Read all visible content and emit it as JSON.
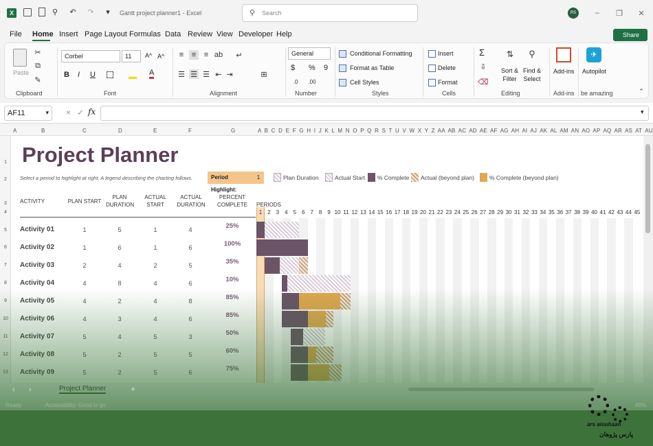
{
  "titlebar": {
    "file_title": "Gantt project planner1",
    "app": "Excel",
    "separator": " - ",
    "search_placeholder": "Search",
    "user_initials": "RS"
  },
  "menu": [
    "File",
    "Home",
    "Insert",
    "Page Layout",
    "Formulas",
    "Data",
    "Review",
    "View",
    "Developer",
    "Help"
  ],
  "share_label": "Share",
  "ribbon": {
    "clipboard": {
      "label": "Clipboard",
      "paste": "Paste"
    },
    "font": {
      "label": "Font",
      "name": "Corbel",
      "size": "11",
      "grow": "A^",
      "shrink": "A^",
      "bold": "B",
      "italic": "I",
      "underline": "U"
    },
    "alignment": {
      "label": "Alignment"
    },
    "number": {
      "label": "Number",
      "format": "General",
      "currency": "$",
      "percent": "%",
      "comma": "9"
    },
    "styles": {
      "label": "Styles",
      "conditional": "Conditional Formatting",
      "as_table": "Format as Table",
      "cell_styles": "Cell Styles"
    },
    "cells": {
      "label": "Cells",
      "insert": "Insert",
      "delete": "Delete",
      "format": "Format"
    },
    "editing": {
      "label": "Editing",
      "sum": "Σ",
      "sort_filter_1": "Sort &",
      "sort_filter_2": "Filter",
      "find_1": "Find &",
      "find_2": "Select"
    },
    "addins": {
      "label": "Add-ins",
      "button": "Add-ins"
    },
    "autopilot": {
      "label": "be amazing",
      "button": "Autopilot"
    }
  },
  "formula_bar": {
    "name_box": "AF11",
    "fx": "fx",
    "cancel": "×",
    "enter": "✓"
  },
  "columns": "A B C D E F G H I J K L M N O P Q R S T U V W X Y Z AA AB AC AD AE AF AG AH AI AJ AK AL AM AN AO AP AQ AR AS AT AU AV AW AX AY AZ",
  "col_labels": {
    "A": "A",
    "B": "B",
    "C": "C",
    "D": "D",
    "E": "E",
    "F": "F",
    "G": "G"
  },
  "rows": [
    "1",
    "2",
    "3",
    "4",
    "5",
    "6",
    "7",
    "8",
    "9",
    "10",
    "11",
    "12",
    "13"
  ],
  "sheet": {
    "title": "Project Planner",
    "instruction": "Select a period to highlight at right.  A legend describing the charting follows.",
    "period_highlight_label": "Period Highlight:",
    "period_highlight_value": "1",
    "legend": {
      "plan": "Plan Duration",
      "actual": "Actual Start",
      "complete": "% Complete",
      "beyond": "Actual (beyond plan)",
      "complete_beyond": "% Complete (beyond plan)"
    },
    "headers": {
      "activity": "ACTIVITY",
      "plan_start": "PLAN START",
      "plan_duration": "PLAN DURATION",
      "actual_start": "ACTUAL START",
      "actual_duration": "ACTUAL DURATION",
      "percent_complete": "PERCENT COMPLETE",
      "periods": "PERIODS"
    },
    "periods": [
      "1",
      "2",
      "3",
      "4",
      "5",
      "6",
      "7",
      "8",
      "9",
      "10",
      "11",
      "12",
      "13",
      "14",
      "15",
      "16",
      "17",
      "18",
      "19",
      "20",
      "21",
      "22",
      "23",
      "24",
      "25",
      "26",
      "27",
      "28",
      "29",
      "30",
      "31",
      "32",
      "33",
      "34",
      "35",
      "36",
      "37",
      "38",
      "39",
      "40",
      "41",
      "42",
      "43",
      "44",
      "45"
    ],
    "activities": [
      {
        "name": "Activity 01",
        "plan_start": "1",
        "plan_duration": "5",
        "actual_start": "1",
        "actual_duration": "4",
        "percent": "25%"
      },
      {
        "name": "Activity 02",
        "plan_start": "1",
        "plan_duration": "6",
        "actual_start": "1",
        "actual_duration": "6",
        "percent": "100%"
      },
      {
        "name": "Activity 03",
        "plan_start": "2",
        "plan_duration": "4",
        "actual_start": "2",
        "actual_duration": "5",
        "percent": "35%"
      },
      {
        "name": "Activity 04",
        "plan_start": "4",
        "plan_duration": "8",
        "actual_start": "4",
        "actual_duration": "6",
        "percent": "10%"
      },
      {
        "name": "Activity 05",
        "plan_start": "4",
        "plan_duration": "2",
        "actual_start": "4",
        "actual_duration": "8",
        "percent": "85%"
      },
      {
        "name": "Activity 06",
        "plan_start": "4",
        "plan_duration": "3",
        "actual_start": "4",
        "actual_duration": "6",
        "percent": "85%"
      },
      {
        "name": "Activity 07",
        "plan_start": "5",
        "plan_duration": "4",
        "actual_start": "5",
        "actual_duration": "3",
        "percent": "50%"
      },
      {
        "name": "Activity 08",
        "plan_start": "5",
        "plan_duration": "2",
        "actual_start": "5",
        "actual_duration": "5",
        "percent": "60%"
      },
      {
        "name": "Activity 09",
        "plan_start": "5",
        "plan_duration": "2",
        "actual_start": "5",
        "actual_duration": "6",
        "percent": "75%"
      }
    ]
  },
  "tabs": {
    "active": "Project Planner",
    "add": "+"
  },
  "status": {
    "ready": "Ready",
    "accessibility": "Accessibility: Good to go",
    "zoom": "80%"
  },
  "watermark": {
    "latin": "ars aiouhaan",
    "persian": "پارس پژوهان"
  },
  "colors": {
    "accent_green": "#1e7145",
    "title_purple": "#5c3f57",
    "bar_purple": "#6b5467",
    "highlight_orange": "#f4c58a",
    "beyond_gold": "#e0a850"
  }
}
